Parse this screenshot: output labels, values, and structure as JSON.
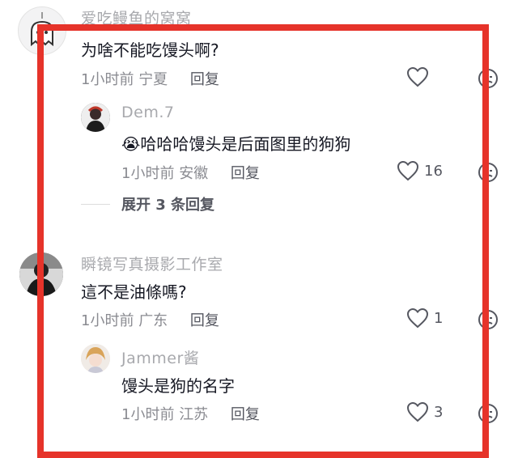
{
  "comments": [
    {
      "username": "爱吃鳗鱼的窝窝",
      "text": "为啥不能吃馒头啊?",
      "time": "1小时前",
      "location": "宁夏",
      "reply_label": "回复",
      "likes": "",
      "replies": [
        {
          "username": "Dem.7",
          "emoji": "😭",
          "text": "哈哈哈馒头是后面图里的狗狗",
          "time": "1小时前",
          "location": "安徽",
          "reply_label": "回复",
          "likes": "16"
        }
      ],
      "expand_label": "展开 3 条回复"
    },
    {
      "username": "瞬镜写真摄影工作室",
      "text": "這不是油條嗎?",
      "time": "1小时前",
      "location": "广东",
      "reply_label": "回复",
      "likes": "1",
      "replies": [
        {
          "username": "Jammer酱",
          "text": "馒头是狗的名字",
          "time": "1小时前",
          "location": "江苏",
          "reply_label": "回复",
          "likes": "3"
        }
      ]
    }
  ],
  "colors": {
    "highlight_box": "#e6332a",
    "username": "#a8a9ad",
    "text": "#161823",
    "meta": "#8a8b91"
  },
  "icons": [
    "heart-icon",
    "dislike-face-icon",
    "ghost-avatar-icon"
  ]
}
